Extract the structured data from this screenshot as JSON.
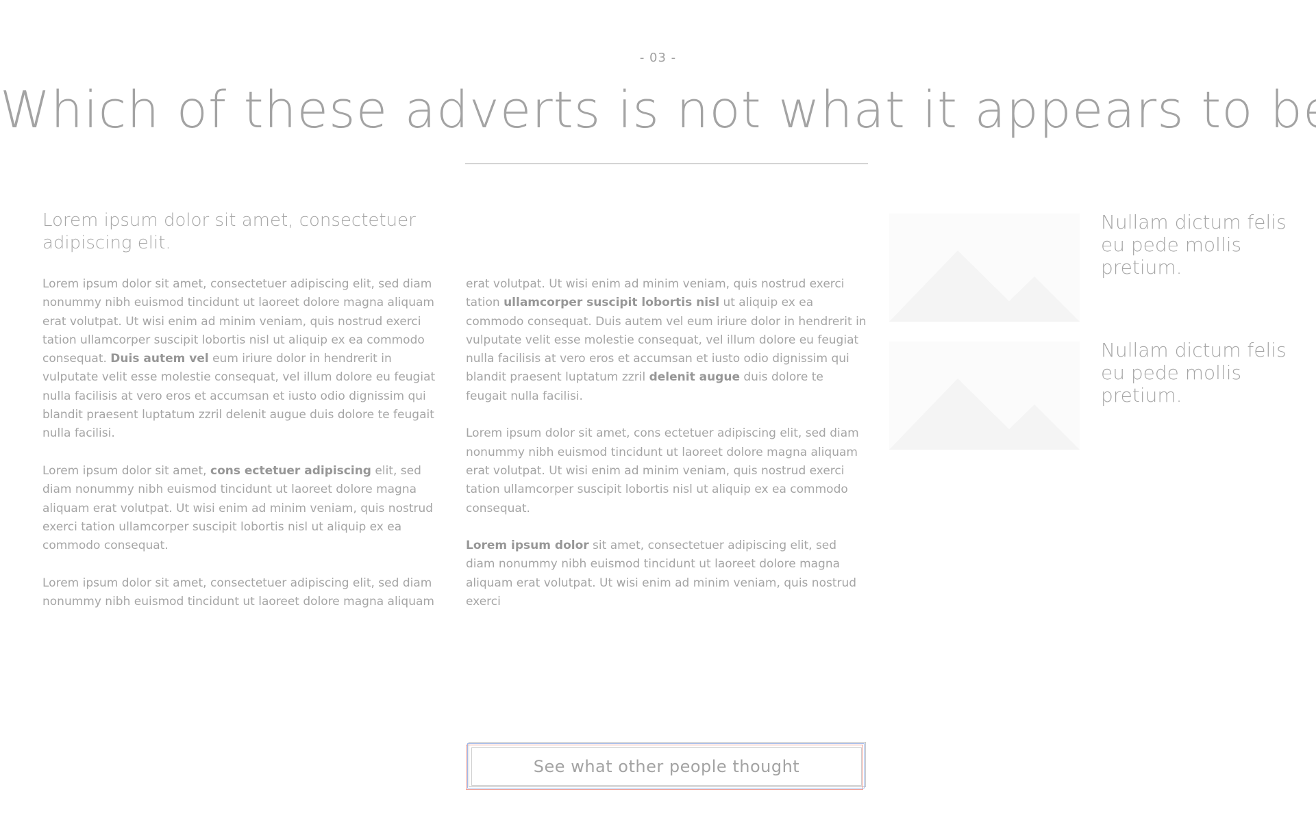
{
  "page": {
    "number": "- 03 -",
    "title": "Which of these adverts is not what it appears to be?"
  },
  "intro": {
    "heading": "Lorem ipsum dolor sit amet, consectetuer adipiscing elit."
  },
  "left_column": {
    "p1": {
      "a": "Lorem ipsum dolor sit amet, consectetuer adipiscing elit, sed diam nonummy nibh euismod tincidunt ut laoreet dolore magna aliquam erat volutpat. Ut wisi enim ad minim veniam, quis nostrud exerci tation ullamcorper suscipit lobortis nisl ut aliquip ex ea commodo consequat. ",
      "bold": "Duis autem vel",
      "b": " eum iriure dolor in hendrerit in vulputate velit esse molestie consequat, vel illum dolore eu feugiat nulla facilisis at vero eros et accumsan et iusto odio dignissim qui blandit praesent luptatum zzril delenit augue duis dolore te feugait nulla facilisi."
    },
    "p2": {
      "a": "Lorem ipsum dolor sit amet, ",
      "bold": "cons ectetuer adipiscing",
      "b": " elit, sed diam nonummy nibh euismod tincidunt ut laoreet dolore magna aliquam erat volutpat. Ut wisi enim ad minim veniam, quis nostrud exerci tation ullamcorper suscipit lobortis nisl ut aliquip ex ea commodo consequat."
    },
    "p3": "Lorem ipsum dolor sit amet, consectetuer adipiscing elit, sed diam nonummy nibh euismod tincidunt ut laoreet dolore magna aliquam"
  },
  "right_column": {
    "p1": {
      "a": "erat volutpat. Ut wisi enim ad minim veniam, quis nostrud exerci tation ",
      "bold1": "ullamcorper suscipit lobortis nisl",
      "b": " ut aliquip ex ea commodo consequat. Duis autem vel eum iriure dolor in hendrerit in vulputate velit esse molestie consequat, vel illum dolore eu feugiat nulla facilisis at vero eros et accumsan et iusto odio dignissim qui blandit praesent luptatum zzril ",
      "bold2": "delenit augue",
      "c": " duis dolore te feugait nulla facilisi."
    },
    "p2": "Lorem ipsum dolor sit amet, cons ectetuer adipiscing elit, sed diam nonummy nibh euismod tincidunt ut laoreet dolore magna aliquam erat volutpat. Ut wisi enim ad minim veniam, quis nostrud exerci tation ullamcorper suscipit lobortis nisl ut aliquip ex ea commodo consequat.",
    "p3": {
      "bold": "Lorem ipsum dolor",
      "a": " sit amet, consectetuer adipiscing elit, sed diam nonummy nibh euismod tincidunt ut laoreet dolore magna aliquam erat volutpat. Ut wisi enim ad minim veniam, quis nostrud exerci"
    }
  },
  "adverts": [
    {
      "caption": "Nullam dictum felis eu pede mollis pretium.",
      "icon": "image-placeholder-icon"
    },
    {
      "caption": "Nullam dictum felis eu pede mollis pretium.",
      "icon": "image-placeholder-icon"
    }
  ],
  "cta": {
    "label": "See what other people thought"
  },
  "colors": {
    "text": "#a5a5a5",
    "divider": "#d4d4d4",
    "cta_border_red": "#f0a39a",
    "cta_border_blue": "#9fb7e8"
  }
}
